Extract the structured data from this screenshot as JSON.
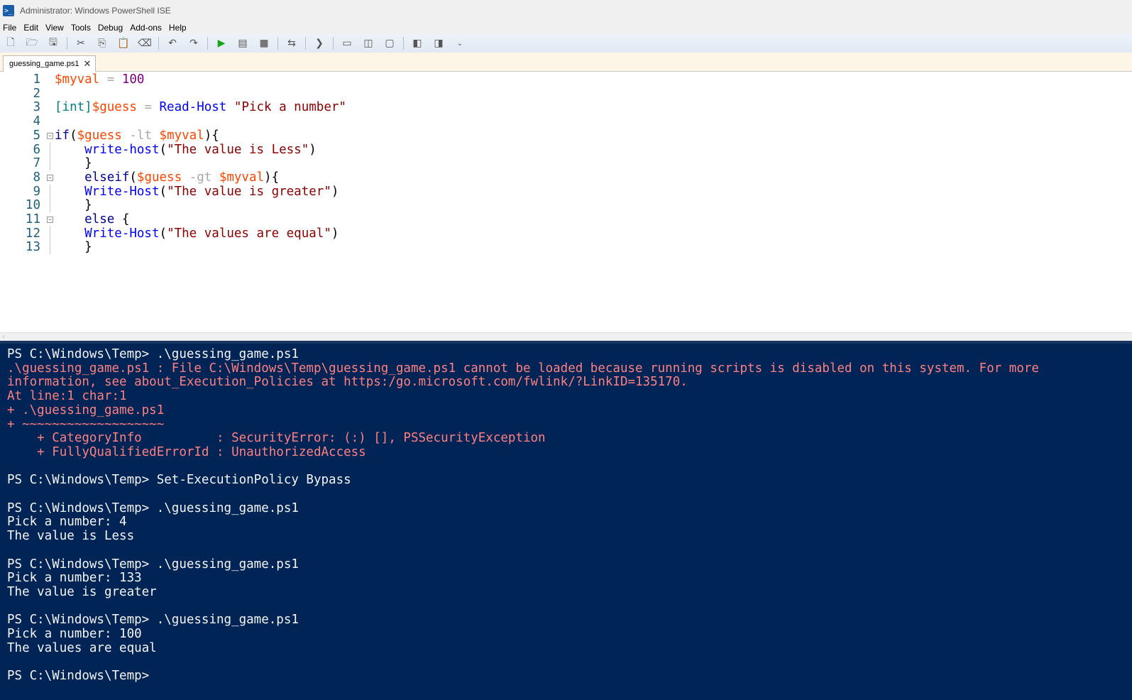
{
  "window": {
    "title": "Administrator: Windows PowerShell ISE",
    "icon": "powershell-icon"
  },
  "menu": [
    "File",
    "Edit",
    "View",
    "Tools",
    "Debug",
    "Add-ons",
    "Help"
  ],
  "toolbar": {
    "buttons": [
      {
        "name": "new-script",
        "glyph": "🗋"
      },
      {
        "name": "open-script",
        "glyph": "🗁"
      },
      {
        "name": "save-script",
        "glyph": "🖫"
      },
      {
        "name": "cut",
        "glyph": "✂"
      },
      {
        "name": "copy",
        "glyph": "⎘"
      },
      {
        "name": "paste",
        "glyph": "📋"
      },
      {
        "name": "clear-console",
        "glyph": "⌫"
      },
      {
        "name": "undo",
        "glyph": "↶"
      },
      {
        "name": "redo",
        "glyph": "↷"
      },
      {
        "name": "run-script",
        "glyph": "▶"
      },
      {
        "name": "run-selection",
        "glyph": "▤"
      },
      {
        "name": "stop",
        "glyph": "■"
      },
      {
        "name": "new-remote-tab",
        "glyph": "⇆"
      },
      {
        "name": "start-powershell",
        "glyph": "❯"
      },
      {
        "name": "show-script-top",
        "glyph": "▭"
      },
      {
        "name": "show-script-right",
        "glyph": "◫"
      },
      {
        "name": "show-script-max",
        "glyph": "▢"
      },
      {
        "name": "show-command-window",
        "glyph": "◧"
      },
      {
        "name": "show-command-addon",
        "glyph": "◨"
      }
    ],
    "overflow": "⌄"
  },
  "tabs": [
    {
      "label": "guessing_game.ps1",
      "active": true
    }
  ],
  "editor": {
    "lines": [
      {
        "n": "1",
        "tokens": [
          [
            "$myval",
            "var"
          ],
          [
            " = ",
            "op"
          ],
          [
            "100",
            "num"
          ]
        ]
      },
      {
        "n": "2",
        "tokens": []
      },
      {
        "n": "3",
        "tokens": [
          [
            "[int]",
            "type"
          ],
          [
            "$guess",
            "var"
          ],
          [
            " = ",
            "op"
          ],
          [
            "Read-Host",
            "cmd"
          ],
          [
            " ",
            "plain"
          ],
          [
            "\"Pick a number\"",
            "str"
          ]
        ]
      },
      {
        "n": "4",
        "tokens": []
      },
      {
        "n": "5",
        "fold": true,
        "tokens": [
          [
            "if",
            "kw"
          ],
          [
            "(",
            "paren"
          ],
          [
            "$guess",
            "var"
          ],
          [
            " -lt ",
            "op"
          ],
          [
            "$myval",
            "var"
          ],
          [
            "){",
            "paren"
          ]
        ]
      },
      {
        "n": "6",
        "tokens": [
          [
            "    write-host",
            "cmd"
          ],
          [
            "(",
            "paren"
          ],
          [
            "\"The value is Less\"",
            "str"
          ],
          [
            ")",
            "paren"
          ]
        ]
      },
      {
        "n": "7",
        "tokens": [
          [
            "    }",
            "paren"
          ]
        ]
      },
      {
        "n": "8",
        "fold": true,
        "tokens": [
          [
            "    elseif",
            "kw"
          ],
          [
            "(",
            "paren"
          ],
          [
            "$guess",
            "var"
          ],
          [
            " -gt ",
            "op"
          ],
          [
            "$myval",
            "var"
          ],
          [
            "){",
            "paren"
          ]
        ]
      },
      {
        "n": "9",
        "tokens": [
          [
            "    Write-Host",
            "cmd"
          ],
          [
            "(",
            "paren"
          ],
          [
            "\"The value is greater\"",
            "str"
          ],
          [
            ")",
            "paren"
          ]
        ]
      },
      {
        "n": "10",
        "tokens": [
          [
            "    }",
            "paren"
          ]
        ]
      },
      {
        "n": "11",
        "fold": true,
        "tokens": [
          [
            "    else",
            "kw"
          ],
          [
            " {",
            "paren"
          ]
        ]
      },
      {
        "n": "12",
        "tokens": [
          [
            "    Write-Host",
            "cmd"
          ],
          [
            "(",
            "paren"
          ],
          [
            "\"The values are equal\"",
            "str"
          ],
          [
            ")",
            "paren"
          ]
        ]
      },
      {
        "n": "13",
        "tokens": [
          [
            "    }",
            "paren"
          ]
        ]
      }
    ]
  },
  "console": {
    "lines": [
      {
        "text": "PS C:\\Windows\\Temp> .\\guessing_game.ps1",
        "kind": "norm"
      },
      {
        "text": ".\\guessing_game.ps1 : File C:\\Windows\\Temp\\guessing_game.ps1 cannot be loaded because running scripts is disabled on this system. For more",
        "kind": "err"
      },
      {
        "text": "information, see about_Execution_Policies at https:/go.microsoft.com/fwlink/?LinkID=135170.",
        "kind": "err"
      },
      {
        "text": "At line:1 char:1",
        "kind": "err"
      },
      {
        "text": "+ .\\guessing_game.ps1",
        "kind": "err"
      },
      {
        "text": "+ ~~~~~~~~~~~~~~~~~~~",
        "kind": "err"
      },
      {
        "text": "    + CategoryInfo          : SecurityError: (:) [], PSSecurityException",
        "kind": "err"
      },
      {
        "text": "    + FullyQualifiedErrorId : UnauthorizedAccess",
        "kind": "err"
      },
      {
        "text": "",
        "kind": "norm"
      },
      {
        "text": "PS C:\\Windows\\Temp> Set-ExecutionPolicy Bypass",
        "kind": "norm"
      },
      {
        "text": "",
        "kind": "norm"
      },
      {
        "text": "PS C:\\Windows\\Temp> .\\guessing_game.ps1",
        "kind": "norm"
      },
      {
        "text": "Pick a number: 4",
        "kind": "norm"
      },
      {
        "text": "The value is Less",
        "kind": "norm"
      },
      {
        "text": "",
        "kind": "norm"
      },
      {
        "text": "PS C:\\Windows\\Temp> .\\guessing_game.ps1",
        "kind": "norm"
      },
      {
        "text": "Pick a number: 133",
        "kind": "norm"
      },
      {
        "text": "The value is greater",
        "kind": "norm"
      },
      {
        "text": "",
        "kind": "norm"
      },
      {
        "text": "PS C:\\Windows\\Temp> .\\guessing_game.ps1",
        "kind": "norm"
      },
      {
        "text": "Pick a number: 100",
        "kind": "norm"
      },
      {
        "text": "The values are equal",
        "kind": "norm"
      },
      {
        "text": "",
        "kind": "norm"
      },
      {
        "text": "PS C:\\Windows\\Temp>",
        "kind": "norm"
      }
    ]
  },
  "colors": {
    "console_bg": "#012456",
    "error": "#ff8080",
    "console_text": "#f5f5f5"
  }
}
